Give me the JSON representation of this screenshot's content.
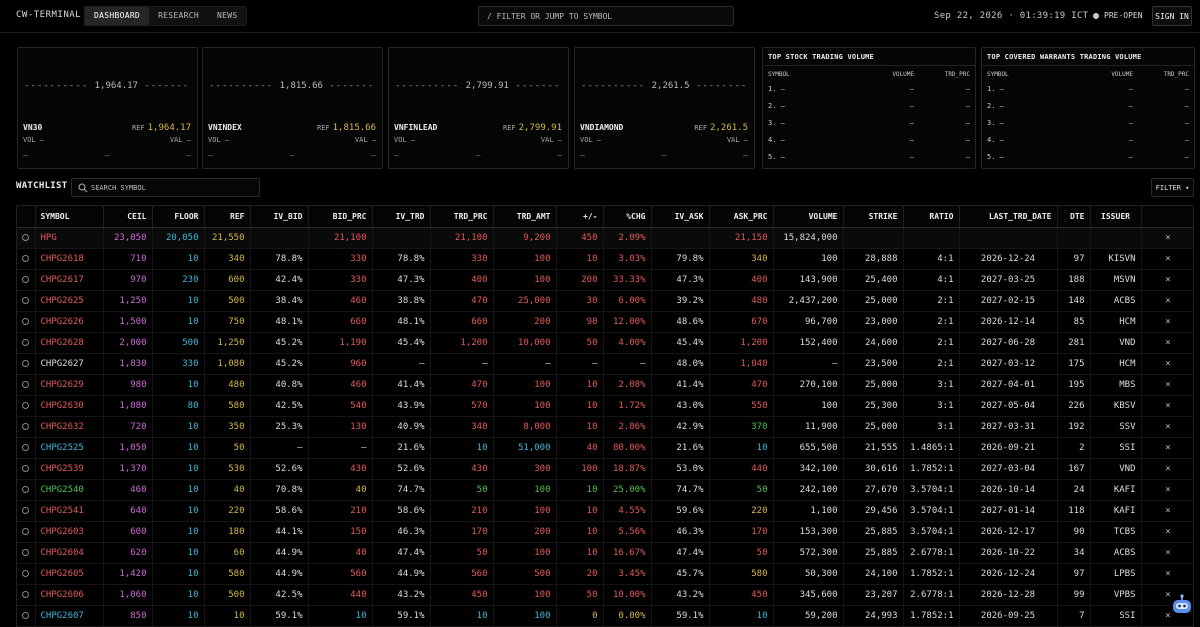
{
  "app": {
    "brand": "CW-TERMINAL",
    "tabs": [
      {
        "label": "DASHBOARD",
        "active": true
      },
      {
        "label": "RESEARCH",
        "active": false
      },
      {
        "label": "NEWS",
        "active": false
      }
    ],
    "command_placeholder": "/ FILTER OR JUMP TO SYMBOL",
    "clock": "Sep 22, 2026 · 01:39:19 ICT",
    "market_status": "PRE-OPEN",
    "sign_in": "SIGN IN"
  },
  "indices": [
    {
      "name": "VN30",
      "value": "1,964.17",
      "ref_label": "REF",
      "ref": "1,964.17",
      "vol": "VOL —",
      "val": "VAL —",
      "c1": "—",
      "c2": "—",
      "c3": "—"
    },
    {
      "name": "VNINDEX",
      "value": "1,815.66",
      "ref_label": "REF",
      "ref": "1,815.66",
      "vol": "VOL —",
      "val": "VAL —",
      "c1": "—",
      "c2": "—",
      "c3": "—"
    },
    {
      "name": "VNFINLEAD",
      "value": "2,799.91",
      "ref_label": "REF",
      "ref": "2,799.91",
      "vol": "VOL —",
      "val": "VAL —",
      "c1": "—",
      "c2": "—",
      "c3": "—"
    },
    {
      "name": "VNDIAMOND",
      "value": "2,261.5",
      "ref_label": "REF",
      "ref": "2,261.5",
      "vol": "VOL —",
      "val": "VAL —",
      "c1": "—",
      "c2": "—",
      "c3": "—"
    }
  ],
  "top_stock": {
    "title": "TOP STOCK TRADING VOLUME",
    "headers": [
      "SYMBOL",
      "VOLUME",
      "TRD_PRC"
    ],
    "rows": [
      [
        "1. —",
        "—",
        "—"
      ],
      [
        "2. —",
        "—",
        "—"
      ],
      [
        "3. —",
        "—",
        "—"
      ],
      [
        "4. —",
        "—",
        "—"
      ],
      [
        "5. —",
        "—",
        "—"
      ]
    ]
  },
  "top_cw": {
    "title": "TOP COVERED WARRANTS TRADING VOLUME",
    "headers": [
      "SYMBOL",
      "VOLUME",
      "TRD_PRC"
    ],
    "rows": [
      [
        "1. —",
        "—",
        "—"
      ],
      [
        "2. —",
        "—",
        "—"
      ],
      [
        "3. —",
        "—",
        "—"
      ],
      [
        "4. —",
        "—",
        "—"
      ],
      [
        "5. —",
        "—",
        "—"
      ]
    ]
  },
  "watchlist": {
    "title": "WATCHLIST",
    "search_placeholder": "SEARCH SYMBOL",
    "filter_label": "FILTER ▾",
    "remove_glyph": "×",
    "columns": [
      "SYMBOL",
      "CEIL",
      "FLOOR",
      "REF",
      "IV_BID",
      "BID_PRC",
      "IV_TRD",
      "TRD_PRC",
      "TRD_AMT",
      "+/-",
      "%CHG",
      "IV_ASK",
      "ASK_PRC",
      "VOLUME",
      "STRIKE",
      "RATIO",
      "LAST_TRD_DATE",
      "DTE",
      "ISSUER"
    ],
    "colors": {
      "up": "#e45a5a",
      "ceil": "#cf6ad6",
      "floor": "#3fb7d9",
      "ref": "#d6b84a",
      "green": "#4fc24f"
    },
    "rows": [
      {
        "sym": "HPG",
        "symc": "up",
        "ceil": "23,050",
        "floor": "20,050",
        "ref": "21,550",
        "iv_bid": "",
        "bid": "21,100",
        "bidc": "up",
        "iv_trd": "",
        "trd": "21,100",
        "trdc": "up",
        "amt": "9,200",
        "amtc": "up",
        "chg": "450",
        "chgc": "up",
        "pct": "2.09%",
        "pctc": "up",
        "iv_ask": "",
        "ask": "21,150",
        "askc": "up",
        "vol": "15,824,000",
        "strike": "",
        "ratio": "",
        "last": "",
        "dte": "",
        "issuer": "",
        "base": true
      },
      {
        "sym": "CHPG2618",
        "symc": "up",
        "ceil": "710",
        "floor": "10",
        "ref": "340",
        "iv_bid": "78.8%",
        "bid": "330",
        "bidc": "up",
        "iv_trd": "78.8%",
        "trd": "330",
        "trdc": "up",
        "amt": "100",
        "amtc": "up",
        "chg": "10",
        "chgc": "up",
        "pct": "3.03%",
        "pctc": "up",
        "iv_ask": "79.8%",
        "ask": "340",
        "askc": "ref",
        "vol": "100",
        "strike": "28,888",
        "ratio": "4:1",
        "last": "2026-12-24",
        "dte": "97",
        "issuer": "KISVN"
      },
      {
        "sym": "CHPG2617",
        "symc": "up",
        "ceil": "970",
        "floor": "230",
        "ref": "600",
        "iv_bid": "42.4%",
        "bid": "330",
        "bidc": "up",
        "iv_trd": "47.3%",
        "trd": "400",
        "trdc": "up",
        "amt": "100",
        "amtc": "up",
        "chg": "200",
        "chgc": "up",
        "pct": "33.33%",
        "pctc": "up",
        "iv_ask": "47.3%",
        "ask": "400",
        "askc": "up",
        "vol": "143,900",
        "strike": "25,400",
        "ratio": "4:1",
        "last": "2027-03-25",
        "dte": "188",
        "issuer": "MSVN"
      },
      {
        "sym": "CHPG2625",
        "symc": "up",
        "ceil": "1,250",
        "floor": "10",
        "ref": "500",
        "iv_bid": "38.4%",
        "bid": "460",
        "bidc": "up",
        "iv_trd": "38.8%",
        "trd": "470",
        "trdc": "up",
        "amt": "25,000",
        "amtc": "up",
        "chg": "30",
        "chgc": "up",
        "pct": "6.00%",
        "pctc": "up",
        "iv_ask": "39.2%",
        "ask": "480",
        "askc": "up",
        "vol": "2,437,200",
        "strike": "25,000",
        "ratio": "2:1",
        "last": "2027-02-15",
        "dte": "148",
        "issuer": "ACBS"
      },
      {
        "sym": "CHPG2626",
        "symc": "up",
        "ceil": "1,500",
        "floor": "10",
        "ref": "750",
        "iv_bid": "48.1%",
        "bid": "660",
        "bidc": "up",
        "iv_trd": "48.1%",
        "trd": "660",
        "trdc": "up",
        "amt": "200",
        "amtc": "up",
        "chg": "90",
        "chgc": "up",
        "pct": "12.00%",
        "pctc": "up",
        "iv_ask": "48.6%",
        "ask": "670",
        "askc": "up",
        "vol": "96,700",
        "strike": "23,000",
        "ratio": "2:1",
        "last": "2026-12-14",
        "dte": "85",
        "issuer": "HCM"
      },
      {
        "sym": "CHPG2628",
        "symc": "up",
        "ceil": "2,000",
        "floor": "500",
        "ref": "1,250",
        "iv_bid": "45.2%",
        "bid": "1,190",
        "bidc": "up",
        "iv_trd": "45.4%",
        "trd": "1,200",
        "trdc": "up",
        "amt": "10,000",
        "amtc": "up",
        "chg": "50",
        "chgc": "up",
        "pct": "4.00%",
        "pctc": "up",
        "iv_ask": "45.4%",
        "ask": "1,200",
        "askc": "up",
        "vol": "152,400",
        "strike": "24,600",
        "ratio": "2:1",
        "last": "2027-06-28",
        "dte": "281",
        "issuer": "VND"
      },
      {
        "sym": "CHPG2627",
        "symc": "white",
        "ceil": "1,830",
        "floor": "330",
        "ref": "1,080",
        "iv_bid": "45.2%",
        "bid": "960",
        "bidc": "up",
        "iv_trd": "—",
        "trd": "—",
        "trdc": "white",
        "amt": "—",
        "amtc": "white",
        "chg": "—",
        "chgc": "white",
        "pct": "—",
        "pctc": "white",
        "iv_ask": "48.0%",
        "ask": "1,040",
        "askc": "up",
        "vol": "—",
        "strike": "23,500",
        "ratio": "2:1",
        "last": "2027-03-12",
        "dte": "175",
        "issuer": "HCM"
      },
      {
        "sym": "CHPG2629",
        "symc": "up",
        "ceil": "980",
        "floor": "10",
        "ref": "480",
        "iv_bid": "40.8%",
        "bid": "460",
        "bidc": "up",
        "iv_trd": "41.4%",
        "trd": "470",
        "trdc": "up",
        "amt": "100",
        "amtc": "up",
        "chg": "10",
        "chgc": "up",
        "pct": "2.08%",
        "pctc": "up",
        "iv_ask": "41.4%",
        "ask": "470",
        "askc": "up",
        "vol": "270,100",
        "strike": "25,000",
        "ratio": "3:1",
        "last": "2027-04-01",
        "dte": "195",
        "issuer": "MBS"
      },
      {
        "sym": "CHPG2630",
        "symc": "up",
        "ceil": "1,080",
        "floor": "80",
        "ref": "580",
        "iv_bid": "42.5%",
        "bid": "540",
        "bidc": "up",
        "iv_trd": "43.9%",
        "trd": "570",
        "trdc": "up",
        "amt": "100",
        "amtc": "up",
        "chg": "10",
        "chgc": "up",
        "pct": "1.72%",
        "pctc": "up",
        "iv_ask": "43.0%",
        "ask": "550",
        "askc": "up",
        "vol": "100",
        "strike": "25,300",
        "ratio": "3:1",
        "last": "2027-05-04",
        "dte": "226",
        "issuer": "KBSV"
      },
      {
        "sym": "CHPG2632",
        "symc": "up",
        "ceil": "720",
        "floor": "10",
        "ref": "350",
        "iv_bid": "25.3%",
        "bid": "130",
        "bidc": "up",
        "iv_trd": "40.9%",
        "trd": "340",
        "trdc": "up",
        "amt": "8,000",
        "amtc": "up",
        "chg": "10",
        "chgc": "up",
        "pct": "2.86%",
        "pctc": "up",
        "iv_ask": "42.9%",
        "ask": "370",
        "askc": "green",
        "vol": "11,900",
        "strike": "25,000",
        "ratio": "3:1",
        "last": "2027-03-31",
        "dte": "192",
        "issuer": "SSV"
      },
      {
        "sym": "CHPG2525",
        "symc": "teal",
        "ceil": "1,050",
        "floor": "10",
        "ref": "50",
        "iv_bid": "—",
        "bid": "—",
        "bidc": "white",
        "iv_trd": "21.6%",
        "trd": "10",
        "trdc": "teal",
        "amt": "51,000",
        "amtc": "teal",
        "chg": "40",
        "chgc": "up",
        "pct": "80.00%",
        "pctc": "up",
        "iv_ask": "21.6%",
        "ask": "10",
        "askc": "teal",
        "vol": "655,500",
        "strike": "21,555",
        "ratio": "1.4865:1",
        "last": "2026-09-21",
        "dte": "2",
        "issuer": "SSI"
      },
      {
        "sym": "CHPG2539",
        "symc": "up",
        "ceil": "1,370",
        "floor": "10",
        "ref": "530",
        "iv_bid": "52.6%",
        "bid": "430",
        "bidc": "up",
        "iv_trd": "52.6%",
        "trd": "430",
        "trdc": "up",
        "amt": "300",
        "amtc": "up",
        "chg": "100",
        "chgc": "up",
        "pct": "18.87%",
        "pctc": "up",
        "iv_ask": "53.0%",
        "ask": "440",
        "askc": "up",
        "vol": "342,100",
        "strike": "30,616",
        "ratio": "1.7852:1",
        "last": "2027-03-04",
        "dte": "167",
        "issuer": "VND"
      },
      {
        "sym": "CHPG2540",
        "symc": "green",
        "ceil": "460",
        "floor": "10",
        "ref": "40",
        "iv_bid": "70.8%",
        "bid": "40",
        "bidc": "ref",
        "iv_trd": "74.7%",
        "trd": "50",
        "trdc": "green",
        "amt": "100",
        "amtc": "green",
        "chg": "10",
        "chgc": "green",
        "pct": "25.00%",
        "pctc": "green",
        "iv_ask": "74.7%",
        "ask": "50",
        "askc": "green",
        "vol": "242,100",
        "strike": "27,670",
        "ratio": "3.5704:1",
        "last": "2026-10-14",
        "dte": "24",
        "issuer": "KAFI"
      },
      {
        "sym": "CHPG2541",
        "symc": "up",
        "ceil": "640",
        "floor": "10",
        "ref": "220",
        "iv_bid": "58.6%",
        "bid": "210",
        "bidc": "up",
        "iv_trd": "58.6%",
        "trd": "210",
        "trdc": "up",
        "amt": "100",
        "amtc": "up",
        "chg": "10",
        "chgc": "up",
        "pct": "4.55%",
        "pctc": "up",
        "iv_ask": "59.6%",
        "ask": "220",
        "askc": "ref",
        "vol": "1,100",
        "strike": "29,456",
        "ratio": "3.5704:1",
        "last": "2027-01-14",
        "dte": "118",
        "issuer": "KAFI"
      },
      {
        "sym": "CHPG2603",
        "symc": "up",
        "ceil": "600",
        "floor": "10",
        "ref": "180",
        "iv_bid": "44.1%",
        "bid": "150",
        "bidc": "up",
        "iv_trd": "46.3%",
        "trd": "170",
        "trdc": "up",
        "amt": "200",
        "amtc": "up",
        "chg": "10",
        "chgc": "up",
        "pct": "5.56%",
        "pctc": "up",
        "iv_ask": "46.3%",
        "ask": "170",
        "askc": "up",
        "vol": "153,300",
        "strike": "25,885",
        "ratio": "3.5704:1",
        "last": "2026-12-17",
        "dte": "90",
        "issuer": "TCBS"
      },
      {
        "sym": "CHPG2604",
        "symc": "up",
        "ceil": "620",
        "floor": "10",
        "ref": "60",
        "iv_bid": "44.9%",
        "bid": "40",
        "bidc": "up",
        "iv_trd": "47.4%",
        "trd": "50",
        "trdc": "up",
        "amt": "100",
        "amtc": "up",
        "chg": "10",
        "chgc": "up",
        "pct": "16.67%",
        "pctc": "up",
        "iv_ask": "47.4%",
        "ask": "50",
        "askc": "up",
        "vol": "572,300",
        "strike": "25,885",
        "ratio": "2.6778:1",
        "last": "2026-10-22",
        "dte": "34",
        "issuer": "ACBS"
      },
      {
        "sym": "CHPG2605",
        "symc": "up",
        "ceil": "1,420",
        "floor": "10",
        "ref": "580",
        "iv_bid": "44.9%",
        "bid": "560",
        "bidc": "up",
        "iv_trd": "44.9%",
        "trd": "560",
        "trdc": "up",
        "amt": "500",
        "amtc": "up",
        "chg": "20",
        "chgc": "up",
        "pct": "3.45%",
        "pctc": "up",
        "iv_ask": "45.7%",
        "ask": "580",
        "askc": "ref",
        "vol": "50,300",
        "strike": "24,100",
        "ratio": "1.7852:1",
        "last": "2026-12-24",
        "dte": "97",
        "issuer": "LPBS"
      },
      {
        "sym": "CHPG2606",
        "symc": "up",
        "ceil": "1,060",
        "floor": "10",
        "ref": "500",
        "iv_bid": "42.5%",
        "bid": "440",
        "bidc": "up",
        "iv_trd": "43.2%",
        "trd": "450",
        "trdc": "up",
        "amt": "100",
        "amtc": "up",
        "chg": "50",
        "chgc": "up",
        "pct": "10.00%",
        "pctc": "up",
        "iv_ask": "43.2%",
        "ask": "450",
        "askc": "up",
        "vol": "345,600",
        "strike": "23,207",
        "ratio": "2.6778:1",
        "last": "2026-12-28",
        "dte": "99",
        "issuer": "VPBS"
      },
      {
        "sym": "CHPG2607",
        "symc": "teal",
        "ceil": "850",
        "floor": "10",
        "ref": "10",
        "iv_bid": "59.1%",
        "bid": "10",
        "bidc": "teal",
        "iv_trd": "59.1%",
        "trd": "10",
        "trdc": "teal",
        "amt": "100",
        "amtc": "teal",
        "chg": "0",
        "chgc": "ref",
        "pct": "0.00%",
        "pctc": "ref",
        "iv_ask": "59.1%",
        "ask": "10",
        "askc": "teal",
        "vol": "59,200",
        "strike": "24,993",
        "ratio": "1.7852:1",
        "last": "2026-09-25",
        "dte": "7",
        "issuer": "SSI"
      }
    ]
  }
}
